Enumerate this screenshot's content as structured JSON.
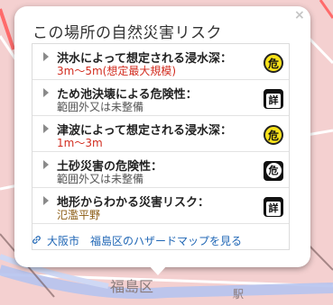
{
  "popup": {
    "title": "この場所の自然災害リスク",
    "close_label": "×",
    "rows": [
      {
        "label": "洪水によって想定される浸水深：",
        "value": "3m～5m(想定最大規模)",
        "badge": "危"
      },
      {
        "label": "ため池決壊による危険性：",
        "value": "範囲外又は未整備",
        "badge": "詳"
      },
      {
        "label": "津波によって想定される浸水深：",
        "value": "1m～3m",
        "badge": "危"
      },
      {
        "label": "土砂災害の危険性：",
        "value": "範囲外又は未整備",
        "badge": "危"
      },
      {
        "label": "地形からわかる災害リスク：",
        "value": "氾濫平野",
        "badge": "詳"
      }
    ],
    "link_text": "大阪市　福島区のハザードマップを見る",
    "link_icon": "link-icon"
  },
  "map": {
    "labels": [
      "福島区",
      "駅"
    ],
    "colors": {
      "flood": "#f2a7a7",
      "river": "#b7c6f0",
      "road": "#ff5a5a"
    }
  }
}
